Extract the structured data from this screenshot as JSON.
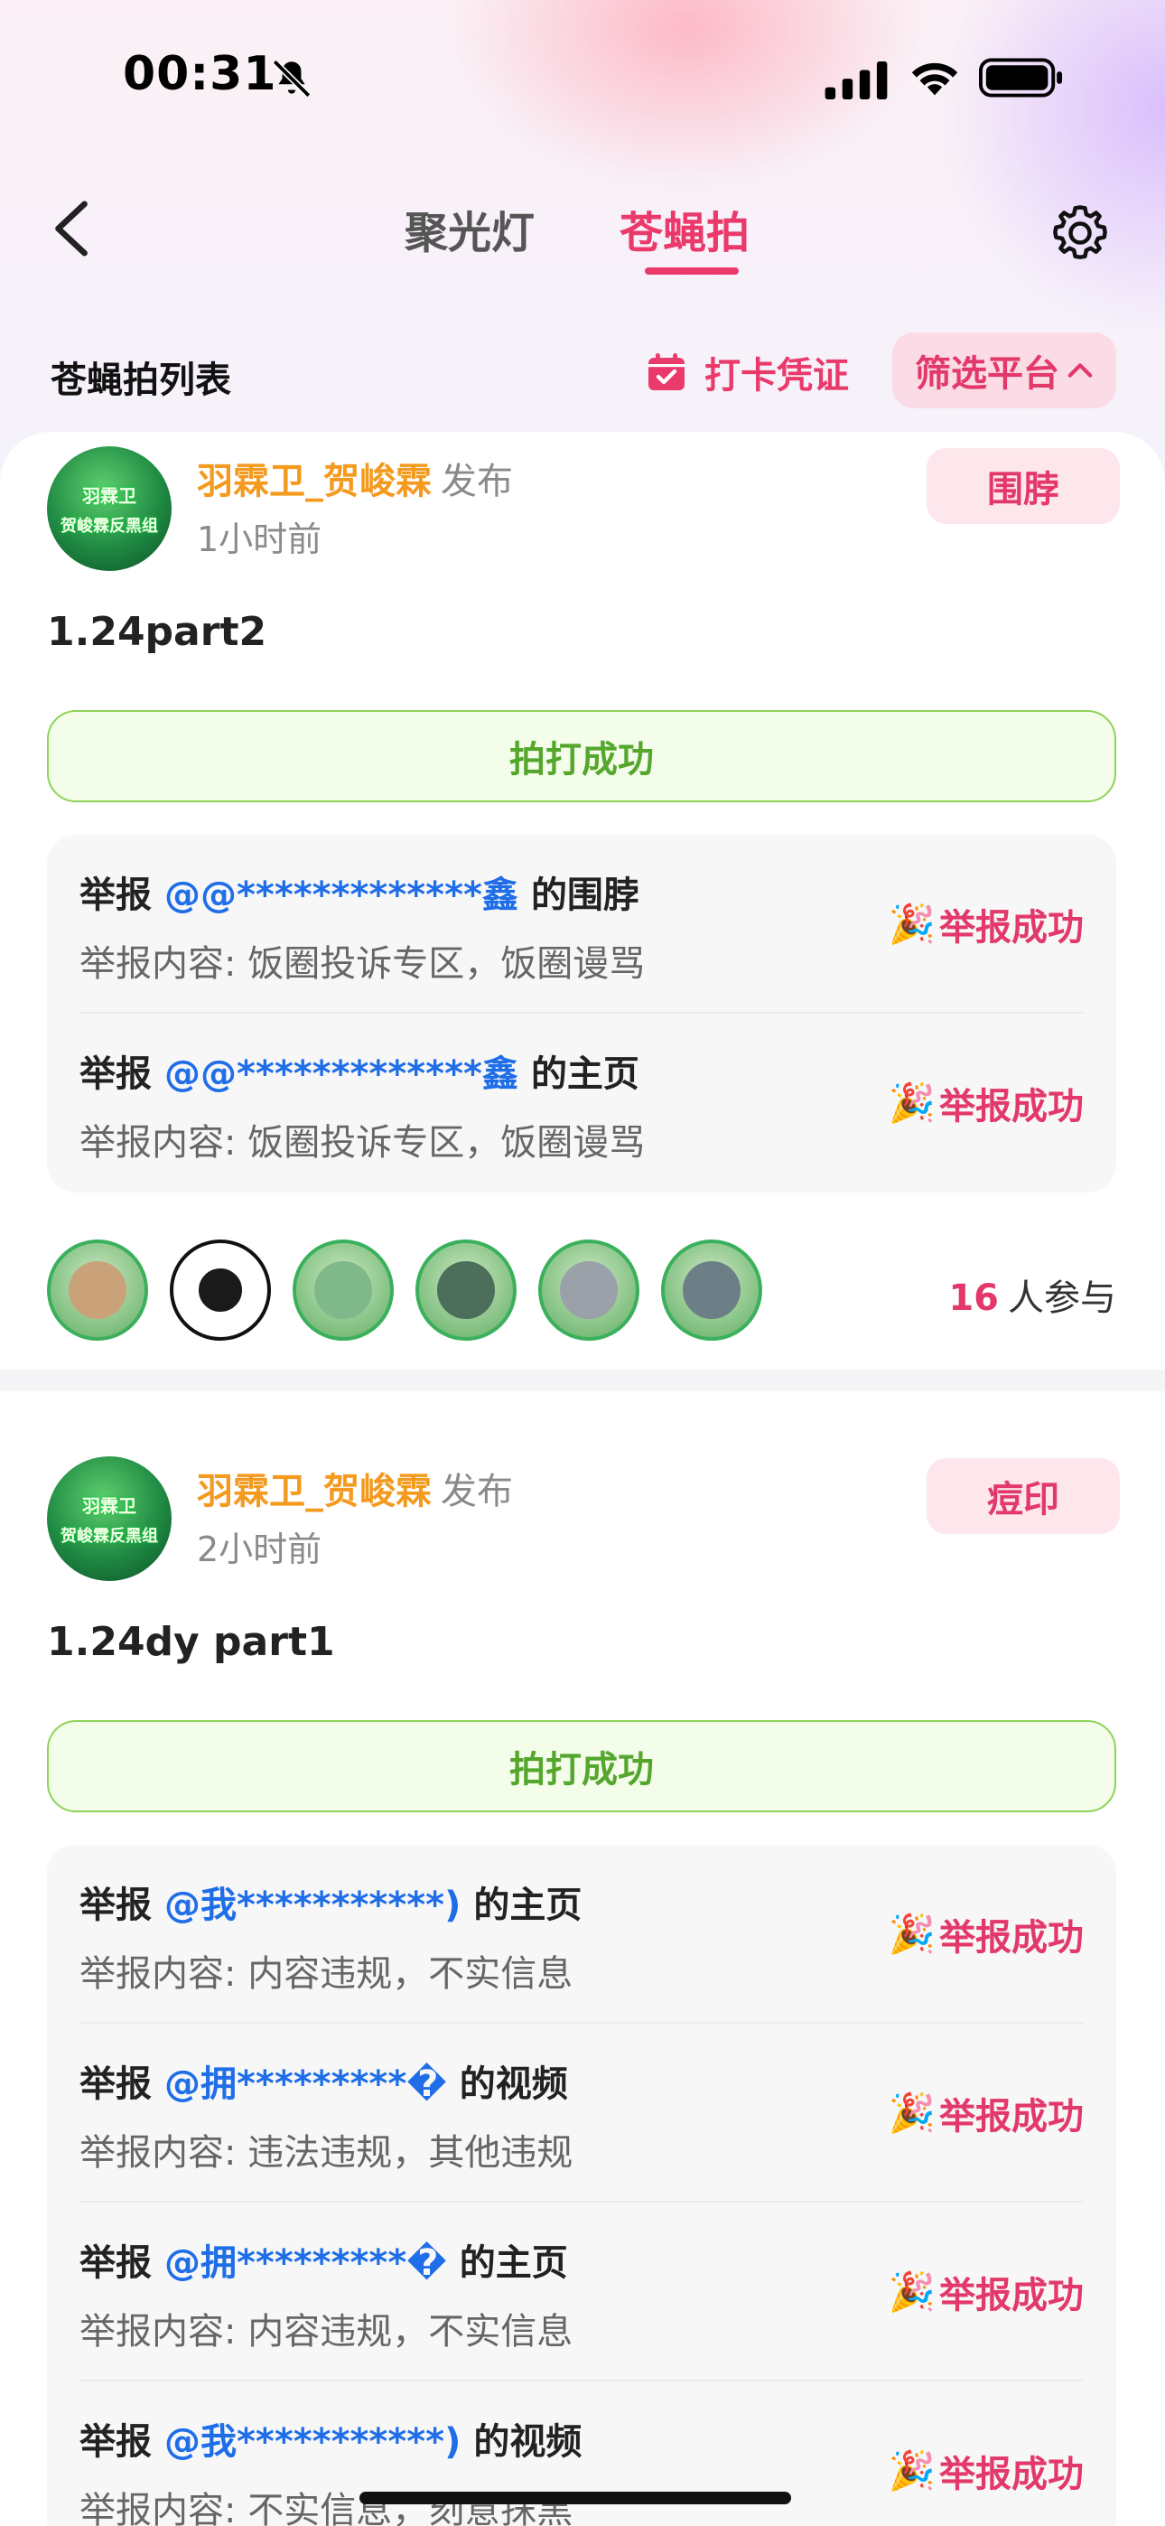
{
  "status_bar": {
    "time": "00:31",
    "silent_icon": "bell-slash-icon",
    "signal_icon": "cellular-signal-icon",
    "wifi_icon": "wifi-icon",
    "battery_icon": "battery-icon"
  },
  "nav": {
    "back_icon": "chevron-left-icon",
    "tabs": [
      {
        "label": "聚光灯",
        "active": false
      },
      {
        "label": "苍蝇拍",
        "active": true
      }
    ],
    "settings_icon": "gear-icon"
  },
  "subheader": {
    "title": "苍蝇拍列表",
    "checkin_label": "打卡凭证",
    "checkin_icon": "calendar-check-icon",
    "filter_label": "筛选平台",
    "filter_icon": "chevron-up-icon"
  },
  "colors": {
    "accent": "#ea3a6b",
    "author": "#f39a1f",
    "link": "#1f6ee8",
    "success": "#55a62d"
  },
  "posts": [
    {
      "author": "羽霖卫_贺峻霖",
      "verb": "发布",
      "time_ago": "1小时前",
      "avatar_text": [
        "羽霖卫",
        "贺峻霖反黑组"
      ],
      "tag": "围脖",
      "title": "1.24part2",
      "result": "拍打成功",
      "reports": [
        {
          "prefix": "举报",
          "target": "@@*************鑫",
          "suffix": "的围脖",
          "content": "举报内容: 饭圈投诉专区，饭圈谩骂",
          "status": "举报成功",
          "status_icon": "party-popper-icon"
        },
        {
          "prefix": "举报",
          "target": "@@*************鑫",
          "suffix": "的主页",
          "content": "举报内容: 饭圈投诉专区，饭圈谩骂",
          "status": "举报成功",
          "status_icon": "party-popper-icon"
        }
      ],
      "participants": {
        "count": "16",
        "label": "人参与"
      }
    },
    {
      "author": "羽霖卫_贺峻霖",
      "verb": "发布",
      "time_ago": "2小时前",
      "avatar_text": [
        "羽霖卫",
        "贺峻霖反黑组"
      ],
      "tag": "痘印",
      "title": "1.24dy part1",
      "result": "拍打成功",
      "reports": [
        {
          "prefix": "举报",
          "target": "@我***********)",
          "suffix": "的主页",
          "content": "举报内容: 内容违规，不实信息",
          "status": "举报成功",
          "status_icon": "party-popper-icon"
        },
        {
          "prefix": "举报",
          "target": "@拥*********�",
          "suffix": "的视频",
          "content": "举报内容: 违法违规，其他违规",
          "status": "举报成功",
          "status_icon": "party-popper-icon"
        },
        {
          "prefix": "举报",
          "target": "@拥*********�",
          "suffix": "的主页",
          "content": "举报内容: 内容违规，不实信息",
          "status": "举报成功",
          "status_icon": "party-popper-icon"
        },
        {
          "prefix": "举报",
          "target": "@我***********)",
          "suffix": "的视频",
          "content": "举报内容: 不实信息，刻意抹黑",
          "status": "举报成功",
          "status_icon": "party-popper-icon"
        }
      ]
    }
  ]
}
